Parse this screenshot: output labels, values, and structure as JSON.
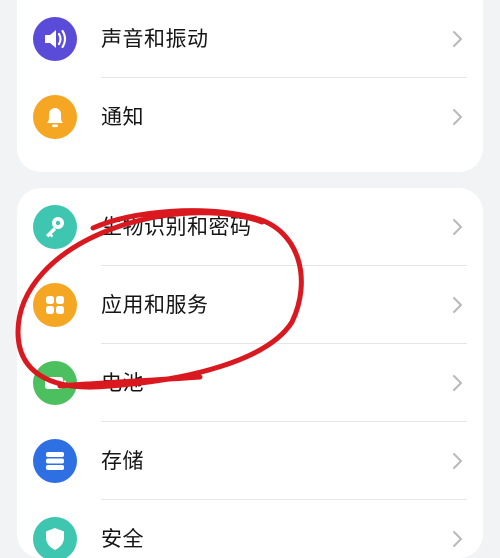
{
  "colors": {
    "background": "#f1f3f5",
    "card": "#ffffff",
    "text": "#151515",
    "chevron": "#b8b8b8",
    "annotation": "#d9191f"
  },
  "group1": {
    "items": [
      {
        "label": "声音和振动",
        "icon": "speaker-icon",
        "icon_color": "#5a4bd8"
      },
      {
        "label": "通知",
        "icon": "bell-icon",
        "icon_color": "#f5a623"
      }
    ]
  },
  "group2": {
    "items": [
      {
        "label": "生物识别和密码",
        "icon": "key-icon",
        "icon_color": "#3ec6b0"
      },
      {
        "label": "应用和服务",
        "icon": "apps-icon",
        "icon_color": "#f5a623"
      },
      {
        "label": "电池",
        "icon": "battery-icon",
        "icon_color": "#4cbf5f"
      },
      {
        "label": "存储",
        "icon": "storage-icon",
        "icon_color": "#2f6fe4"
      },
      {
        "label": "安全",
        "icon": "shield-icon",
        "icon_color": "#3ec6b0"
      }
    ]
  }
}
